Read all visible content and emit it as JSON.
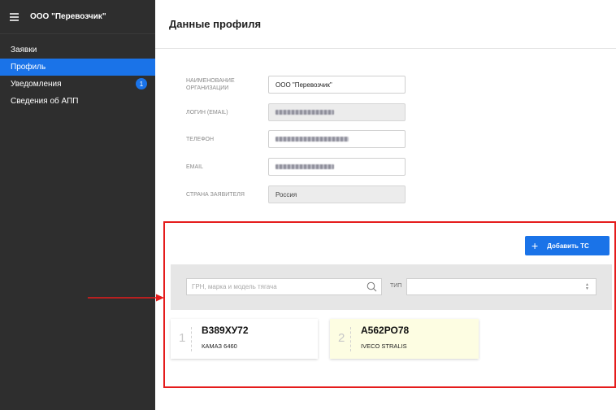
{
  "sidebar": {
    "title": "ООО \"Перевозчик\"",
    "items": [
      {
        "label": "Заявки",
        "active": false
      },
      {
        "label": "Профиль",
        "active": true
      },
      {
        "label": "Уведомления",
        "active": false,
        "badge": "1"
      },
      {
        "label": "Сведения об АПП",
        "active": false
      }
    ]
  },
  "page": {
    "title": "Данные профиля"
  },
  "profile_form": {
    "org_name_label": "НАИМЕНОВАНИЕ ОРГАНИЗАЦИИ",
    "org_name_value": "ООО \"Перевозчик\"",
    "login_label": "ЛОГИН (EMAIL)",
    "phone_label": "ТЕЛЕФОН",
    "email_label": "EMAIL",
    "country_label": "СТРАНА ЗАЯВИТЕЛЯ",
    "country_value": "Россия"
  },
  "vehicles": {
    "add_button_label": "Добавить ТС",
    "search_placeholder": "ГРН, марка и модель тягача",
    "type_label": "ТИП",
    "type_selected": "",
    "items": [
      {
        "index": "1",
        "plate": "В389ХУ72",
        "model": "КАМАЗ 6460",
        "highlighted": false
      },
      {
        "index": "2",
        "plate": "А562РО78",
        "model": "IVECO STRALIS",
        "highlighted": true
      }
    ]
  },
  "colors": {
    "sidebar_bg": "#2e2e2e",
    "accent": "#1a73e8",
    "annotation_red": "#e51c1c",
    "highlight_card": "#fdfde2"
  },
  "icons": [
    "hamburger-menu-icon",
    "plus-icon",
    "search-icon",
    "select-arrows-icon"
  ]
}
